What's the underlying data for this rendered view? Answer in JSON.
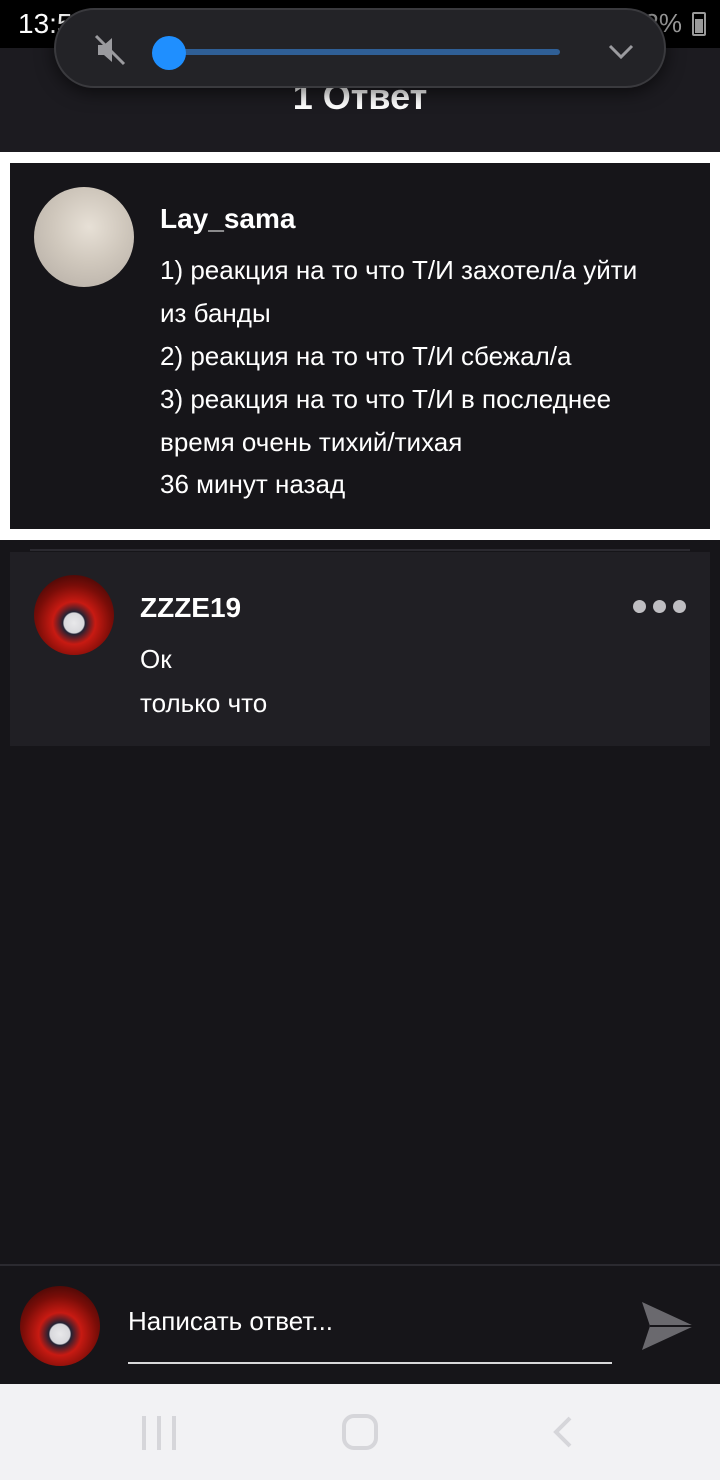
{
  "status_bar": {
    "time": "13:59",
    "notif_icons": "W W",
    "battery": "72%"
  },
  "header": {
    "title": "1 Ответ"
  },
  "volume_overlay": {
    "level": 0.0
  },
  "main_comment": {
    "username": "Lay_sama",
    "text": "1) реакция на то что Т/И захотел/а уйти\nиз банды\n2) реакция на то что Т/И сбежал/а\n3) реакция на то что Т/И в последнее\nвремя очень тихий/тихая",
    "timestamp": "36 минут назад"
  },
  "reply": {
    "username": "ZZZE19",
    "text": "Ок",
    "timestamp": "только что"
  },
  "composer": {
    "placeholder": "Написать ответ..."
  },
  "colors": {
    "accent": "#1f8fff",
    "background": "#161519",
    "card": "#201f24"
  }
}
